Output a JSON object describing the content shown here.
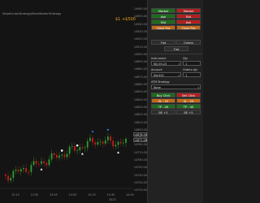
{
  "chart": {
    "title": "NinjaScriptStrategy/BarsWorkerStrategy",
    "pnl": "$1 +$500",
    "y_ticks": [
      "14960.00",
      "14950.00",
      "14940.00",
      "14930.00",
      "14920.00",
      "14910.00",
      "14900.00",
      "14890.00",
      "14880.00",
      "14870.00",
      "14860.00",
      "14850.00",
      "14840.00",
      "14830.00",
      "14820.00",
      "14810.00",
      "14800.00",
      "14790.00",
      "14780.00",
      "14770.00",
      "14760.00",
      "14750.00",
      "14740.00",
      "14730.00",
      "14720.00"
    ],
    "x_ticks": [
      "13:15",
      "13:30",
      "13:45",
      "14:00",
      "14:15",
      "14:30",
      "14:45"
    ],
    "price_tag_1": "14876.50",
    "price_tag_2": "14871.00",
    "x_footer": "2023",
    "colors": {
      "up": "#2e9e2e",
      "down": "#c41c1c",
      "background": "#141414",
      "text": "#8a8a8a",
      "signal_white": "#ffffff",
      "signal_blue": "#2a7fff"
    }
  },
  "panel": {
    "row1": {
      "left": "Market",
      "right": "Market"
    },
    "row2": {
      "left": "Ask",
      "right": "Bid"
    },
    "row3": {
      "left": "Bid",
      "right": "Ask"
    },
    "row4": {
      "left": "Close Pos",
      "right": "Close Pos"
    },
    "row5": {
      "left": "Flat",
      "right": "Orders"
    },
    "row6": {
      "center": "Flat"
    },
    "instrument_label": "Instrument",
    "instrument_value": "NQ 09-23",
    "qty_label": "Qty",
    "qty_value": "1",
    "account_label": "Account",
    "account_value": "Sim101",
    "orders_label": "Orders qty",
    "orders_value": "1",
    "atm_label": "ATM Strategy",
    "atm_value": "None",
    "buy_click": "Buy Click",
    "sell_click": "Sell Click",
    "sl_left": "SL - 20",
    "sl_right": "SL - 20",
    "tp_left": "TP - 40",
    "tp_right": "TP - 40",
    "be_left": "BE +5",
    "be_right": "BE +5"
  }
}
